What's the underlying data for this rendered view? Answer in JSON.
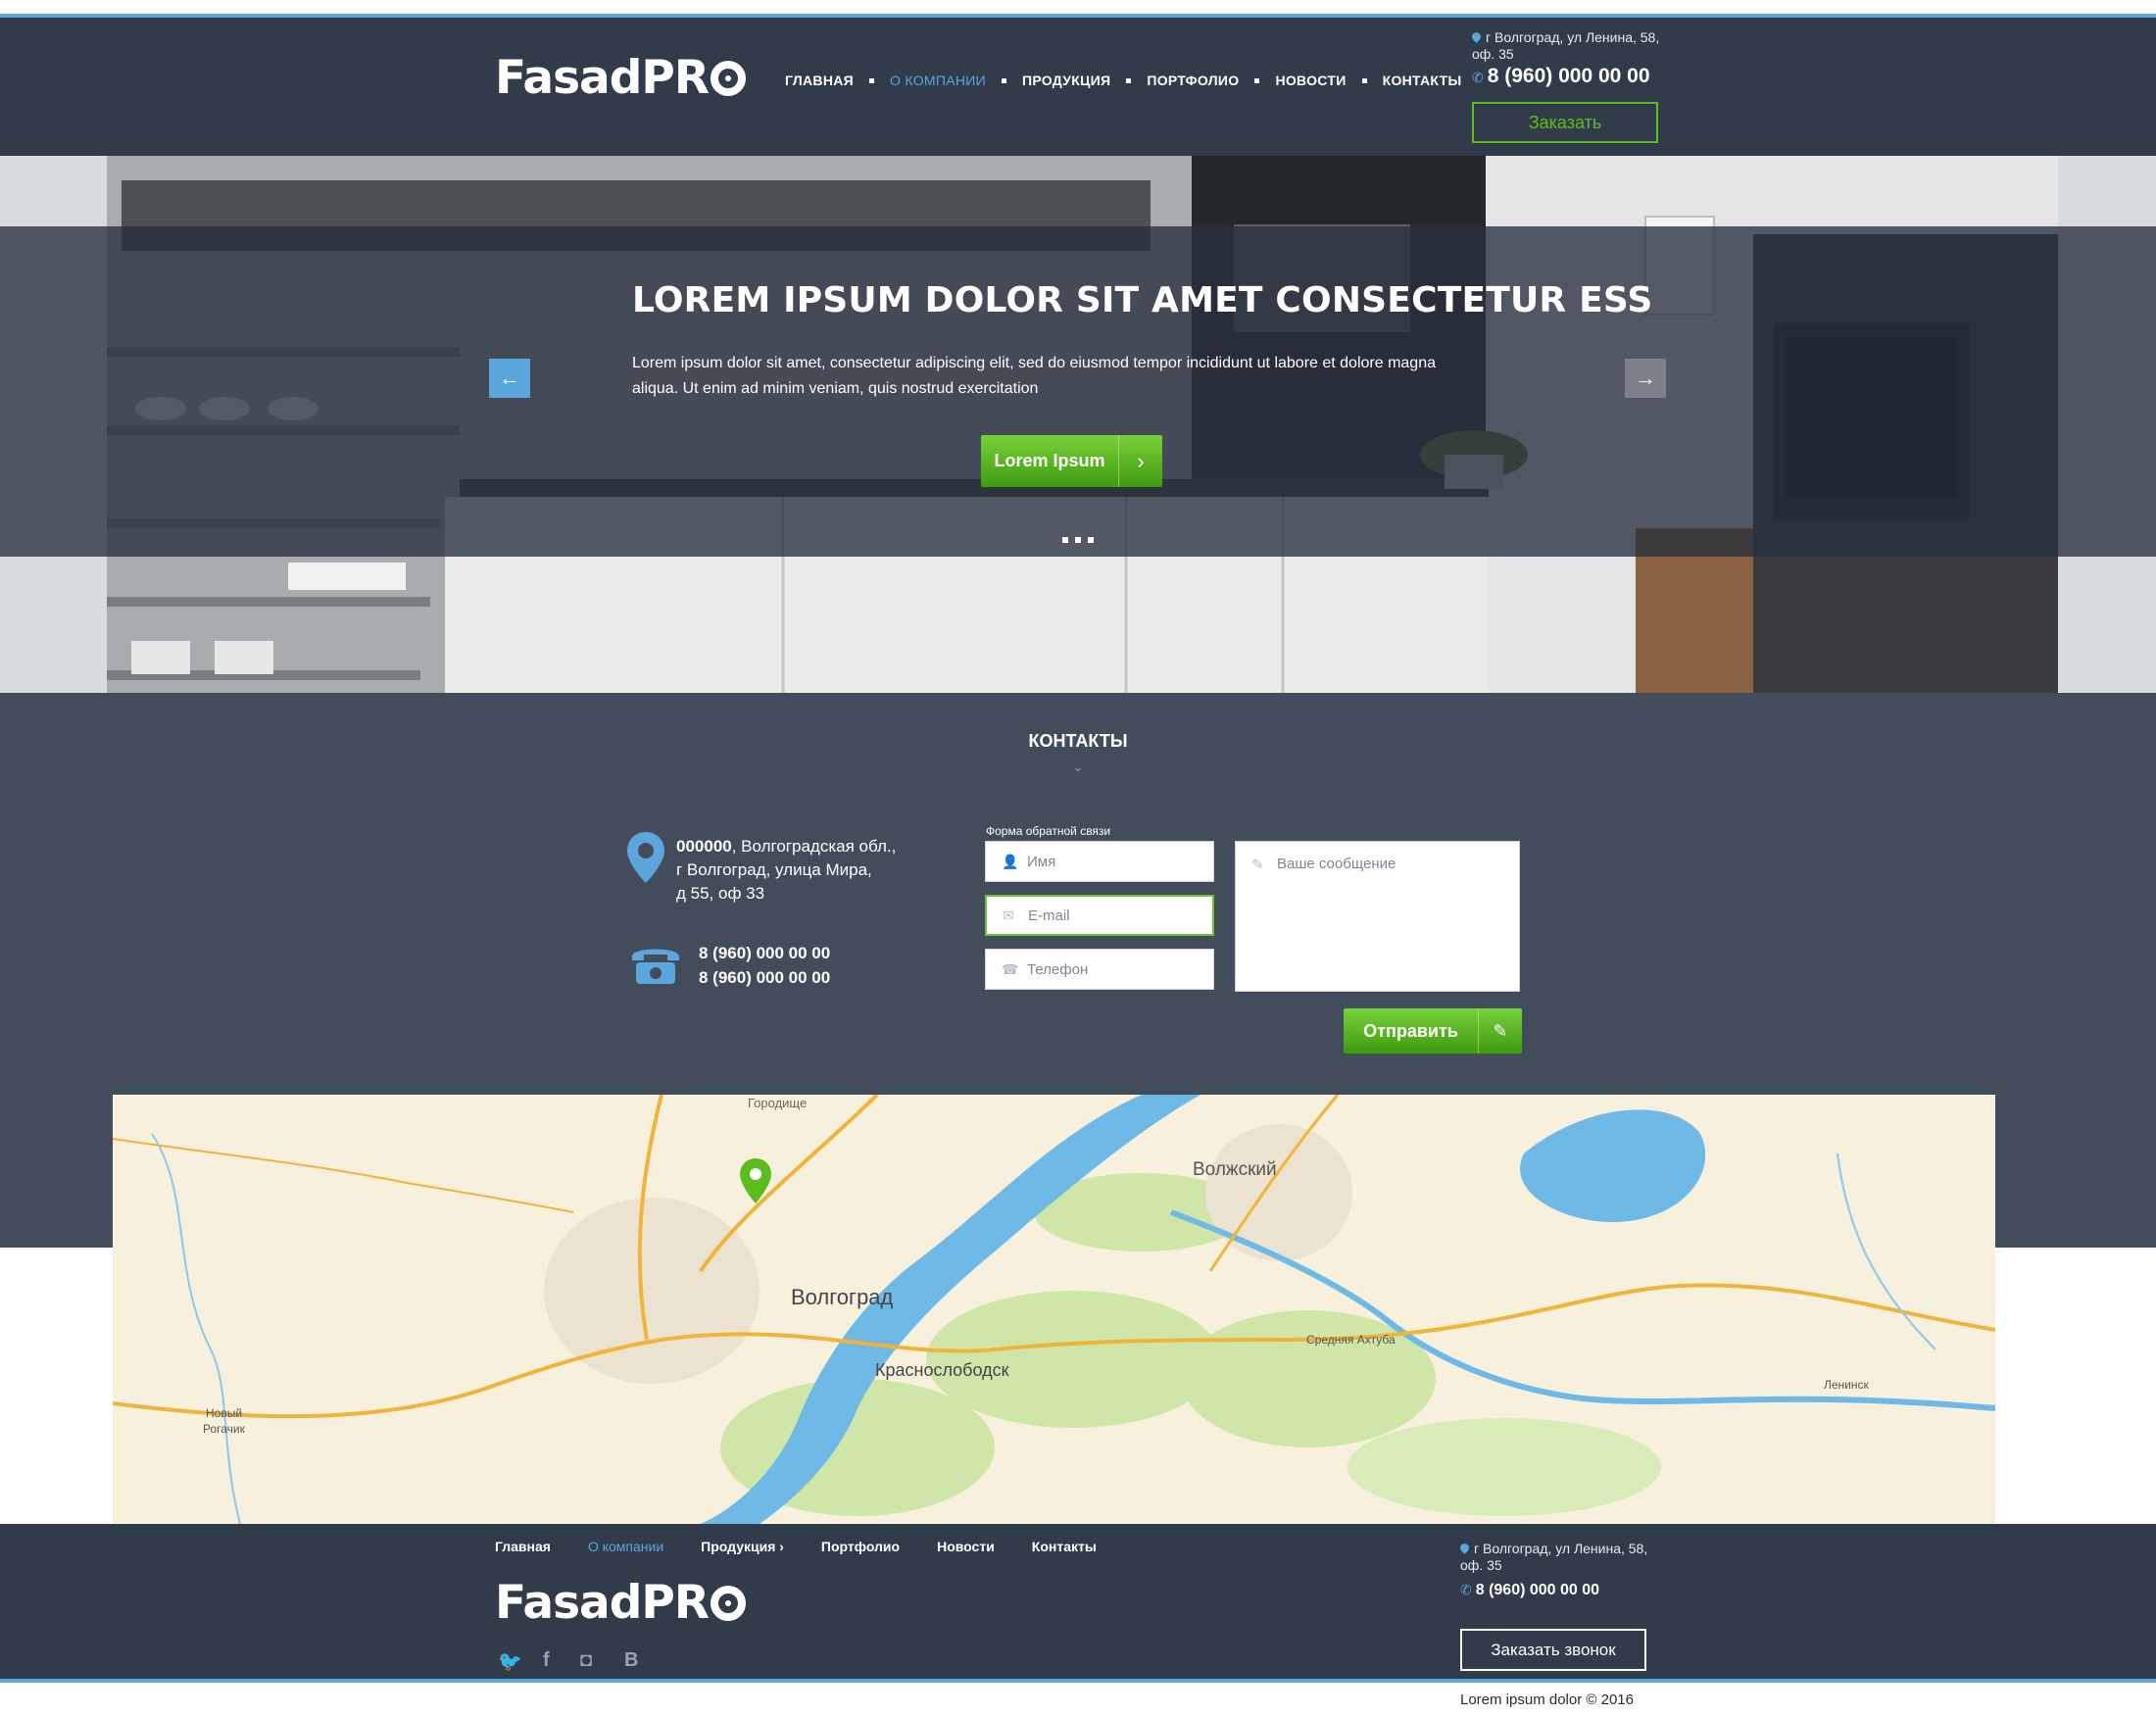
{
  "brand": {
    "logo_text": "FasadPR"
  },
  "header": {
    "nav": [
      {
        "label": "ГЛАВНАЯ",
        "active": false
      },
      {
        "label": "О КОМПАНИИ",
        "active": true
      },
      {
        "label": "ПРОДУКЦИЯ",
        "active": false
      },
      {
        "label": "ПОРТФОЛИО",
        "active": false
      },
      {
        "label": "НОВОСТИ",
        "active": false
      },
      {
        "label": "КОНТАКТЫ",
        "active": false
      }
    ],
    "address_line1": "г Волгоград, ул Ленина, 58,",
    "address_line2": "оф. 35",
    "phone": "8 (960) 000 00 00",
    "order_button": "Заказать"
  },
  "hero": {
    "title": "LOREM IPSUM DOLOR SIT AMET CONSECTETUR ESS",
    "text": "Lorem ipsum dolor sit amet, consectetur adipiscing elit, sed do eiusmod tempor incididunt ut labore et dolore magna aliqua. Ut enim ad minim veniam, quis nostrud exercitation",
    "button_label": "Lorem Ipsum",
    "slides": 3
  },
  "contacts": {
    "section_title": "КОНТАКТЫ",
    "address_bold": "000000",
    "address_rest": ", Волгоградская обл.,",
    "address_line2": "г Волгоград, улица Мира,",
    "address_line3": "д 55, оф 33",
    "phone1": "8 (960) 000 00 00",
    "phone2": "8 (960) 000 00 00",
    "form_label": "Форма обратной связи",
    "name_placeholder": "Имя",
    "email_placeholder": "E-mail",
    "phone_placeholder": "Телефон",
    "message_placeholder": "Ваше сообщение",
    "send_button": "Отправить"
  },
  "map": {
    "labels": [
      "Городище",
      "Волжский",
      "Волгоград",
      "Краснослободск",
      "Средняя Ахтуба",
      "Новый",
      "Рогачик",
      "Ленинск"
    ]
  },
  "footer": {
    "nav": [
      {
        "label": "Главная",
        "active": false
      },
      {
        "label": "О компании",
        "active": true
      },
      {
        "label": "Продукция ›",
        "active": false
      },
      {
        "label": "Портфолио",
        "active": false
      },
      {
        "label": "Новости",
        "active": false
      },
      {
        "label": "Контакты",
        "active": false
      }
    ],
    "address_line1": "г Волгоград, ул Ленина, 58,",
    "address_line2": "оф. 35",
    "phone": "8 (960) 000 00 00",
    "call_button": "Заказать звонок",
    "copyright": "Lorem ipsum dolor © 2016",
    "social": [
      {
        "icon": "twitter-icon",
        "glyph": "🐦"
      },
      {
        "icon": "facebook-icon",
        "glyph": "f"
      },
      {
        "icon": "instagram-icon",
        "glyph": "◘"
      },
      {
        "icon": "vk-icon",
        "glyph": "В"
      }
    ]
  },
  "colors": {
    "header_bg": "#323b4a",
    "accent_blue": "#5aa6dd",
    "accent_green": "#5dbd1e",
    "contacts_bg": "#434c5a"
  }
}
